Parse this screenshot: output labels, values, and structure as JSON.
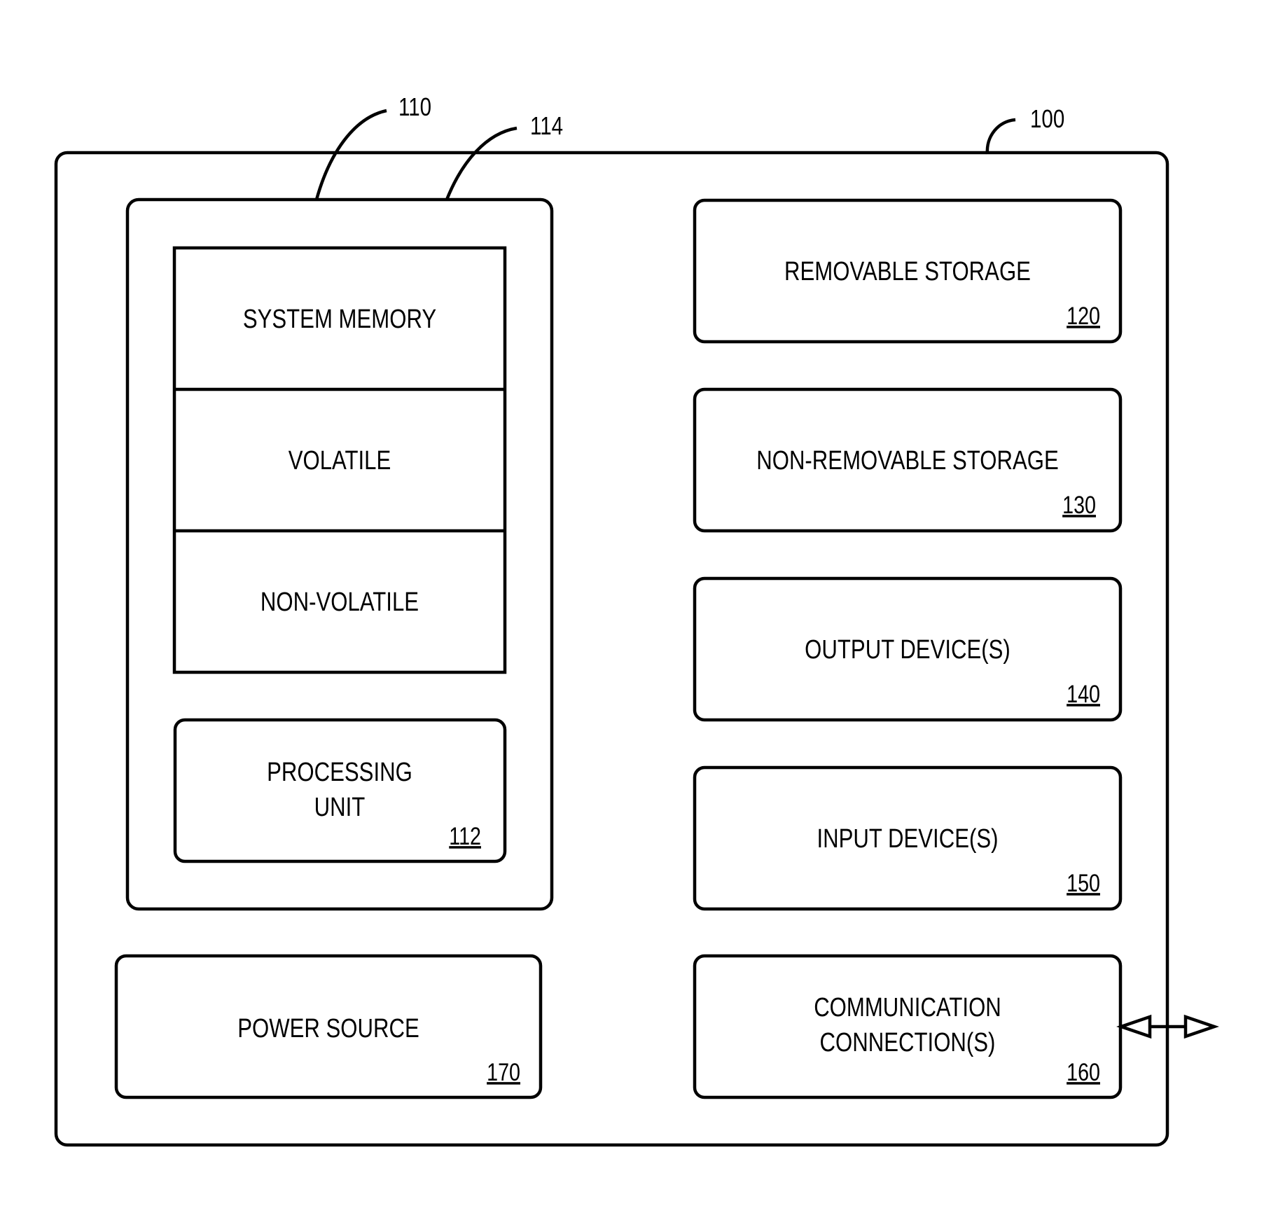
{
  "figure": {
    "device": {
      "ref": "100"
    },
    "memory_group": {
      "ref": "110",
      "memory_ref": "114",
      "rows": [
        {
          "label": "SYSTEM MEMORY"
        },
        {
          "label": "VOLATILE"
        },
        {
          "label": "NON-VOLATILE"
        }
      ],
      "processing_unit": {
        "lines": [
          "PROCESSING",
          "UNIT"
        ],
        "ref": "112"
      }
    },
    "power_source": {
      "label": "POWER SOURCE",
      "ref": "170"
    },
    "components": [
      {
        "lines": [
          "REMOVABLE STORAGE"
        ],
        "ref": "120"
      },
      {
        "lines": [
          "NON-REMOVABLE STORAGE"
        ],
        "ref": "130"
      },
      {
        "lines": [
          "OUTPUT DEVICE(S)"
        ],
        "ref": "140"
      },
      {
        "lines": [
          "INPUT DEVICE(S)"
        ],
        "ref": "150"
      },
      {
        "lines": [
          "COMMUNICATION",
          "CONNECTION(S)"
        ],
        "ref": "160"
      }
    ],
    "connection_arrow": {
      "direction": "bidirectional"
    }
  }
}
